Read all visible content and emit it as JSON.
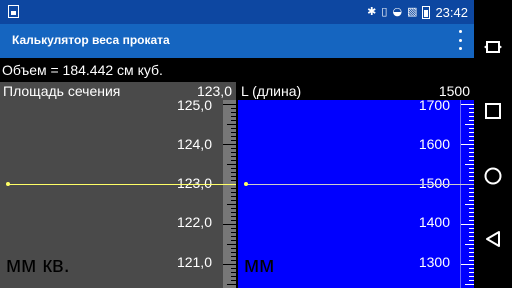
{
  "status_bar": {
    "icons": [
      "gallery-icon",
      "bluetooth-icon",
      "vibrate-icon",
      "wifi-icon",
      "no-sim-icon",
      "battery-icon"
    ],
    "time": "23:42"
  },
  "app_bar": {
    "title": "Калькулятор веса проката",
    "menu_icon": "overflow-menu-icon"
  },
  "result": {
    "text": "Объем = 184.442 см куб."
  },
  "left_panel": {
    "label": "Площадь сечения",
    "value": "123,0",
    "scale": [
      "125,0",
      "124,0",
      "123,0",
      "122,0",
      "121,0"
    ],
    "unit": "мм кв.",
    "background": "#4a4a4a"
  },
  "right_panel": {
    "label": "L (длина)",
    "value": "1500",
    "scale": [
      "1700",
      "1600",
      "1500",
      "1400",
      "1300"
    ],
    "unit": "мм",
    "background": "#0000ff"
  },
  "nav_bar": {
    "icons": [
      "screen-rotate-icon",
      "recents-icon",
      "home-icon",
      "back-icon"
    ]
  },
  "colors": {
    "status_bar": "#0d47a1",
    "app_bar": "#1565c0",
    "indicator": "#ffff66"
  }
}
